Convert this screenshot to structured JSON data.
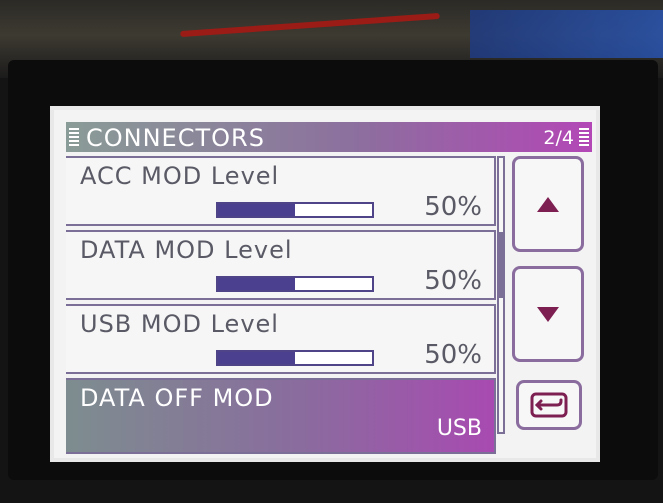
{
  "header": {
    "title": "CONNECTORS",
    "page": "2/4"
  },
  "items": [
    {
      "label": "ACC MOD Level",
      "level": 50,
      "value": "50%"
    },
    {
      "label": "DATA MOD Level",
      "level": 50,
      "value": "50%"
    },
    {
      "label": "USB MOD Level",
      "level": 50,
      "value": "50%"
    },
    {
      "label": "DATA OFF MOD",
      "value": "USB",
      "selected": true
    }
  ],
  "controls": {
    "up_icon": "arrow-up-icon",
    "down_icon": "arrow-down-icon",
    "back_icon": "return-icon"
  },
  "colors": {
    "accent": "#8a6c9e",
    "bar": "#4b3f8f",
    "arrow": "#7e1f52"
  }
}
